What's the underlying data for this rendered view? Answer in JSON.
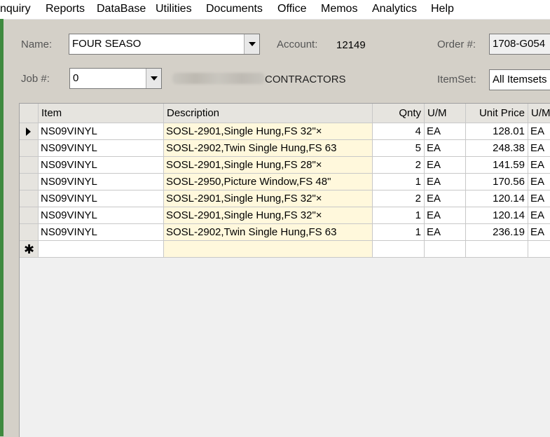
{
  "menu": [
    "nquiry",
    "Reports",
    "DataBase",
    "Utilities",
    "Documents",
    "Office",
    "Memos",
    "Analytics",
    "Help"
  ],
  "header": {
    "name_label": "Name:",
    "name_value": "FOUR SEASO",
    "account_label": "Account:",
    "account_value": "12149",
    "order_label": "Order #:",
    "order_value": "1708-G054",
    "job_label": "Job #:",
    "job_value": "0",
    "job_desc_visible": "CONTRACTORS",
    "itemset_label": "ItemSet:",
    "itemset_value": "All Itemsets"
  },
  "grid": {
    "columns": [
      "Item",
      "Description",
      "Qnty",
      "U/M",
      "Unit Price",
      "U/M"
    ],
    "rows": [
      {
        "item": "NS09VINYL",
        "desc": "SOSL-2901,Single Hung,FS 32\"×",
        "qty": "4",
        "um": "EA",
        "price": "128.01",
        "um2": "EA"
      },
      {
        "item": "NS09VINYL",
        "desc": "SOSL-2902,Twin Single Hung,FS 63",
        "qty": "5",
        "um": "EA",
        "price": "248.38",
        "um2": "EA"
      },
      {
        "item": "NS09VINYL",
        "desc": "SOSL-2901,Single Hung,FS 28\"×",
        "qty": "2",
        "um": "EA",
        "price": "141.59",
        "um2": "EA"
      },
      {
        "item": "NS09VINYL",
        "desc": "SOSL-2950,Picture Window,FS 48\"",
        "qty": "1",
        "um": "EA",
        "price": "170.56",
        "um2": "EA"
      },
      {
        "item": "NS09VINYL",
        "desc": "SOSL-2901,Single Hung,FS 32\"×",
        "qty": "2",
        "um": "EA",
        "price": "120.14",
        "um2": "EA"
      },
      {
        "item": "NS09VINYL",
        "desc": "SOSL-2901,Single Hung,FS 32\"×",
        "qty": "1",
        "um": "EA",
        "price": "120.14",
        "um2": "EA"
      },
      {
        "item": "NS09VINYL",
        "desc": "SOSL-2902,Twin Single Hung,FS 63",
        "qty": "1",
        "um": "EA",
        "price": "236.19",
        "um2": "EA"
      }
    ],
    "new_row_marker": "✱"
  }
}
